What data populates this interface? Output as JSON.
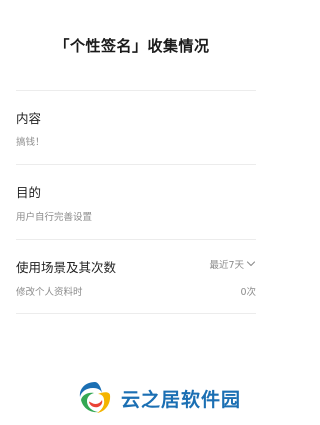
{
  "page": {
    "title": "「个性签名」收集情况"
  },
  "content_section": {
    "label": "内容",
    "value": "搞钱！"
  },
  "purpose_section": {
    "label": "目的",
    "value": "用户自行完善设置"
  },
  "usage_section": {
    "label": "使用场景及其次数",
    "period": "最近7天",
    "scenario": "修改个人资料时",
    "count": "0次"
  },
  "watermark": {
    "text": "云之居软件园"
  },
  "colors": {
    "text_primary": "#1f1f1f",
    "text_secondary": "#8c8c8c",
    "divider": "#ececec",
    "watermark_blue": "#1b6fb3"
  },
  "icons": {
    "period_chevron": "chevron-down-icon",
    "watermark_logo": "swirl-logo"
  }
}
